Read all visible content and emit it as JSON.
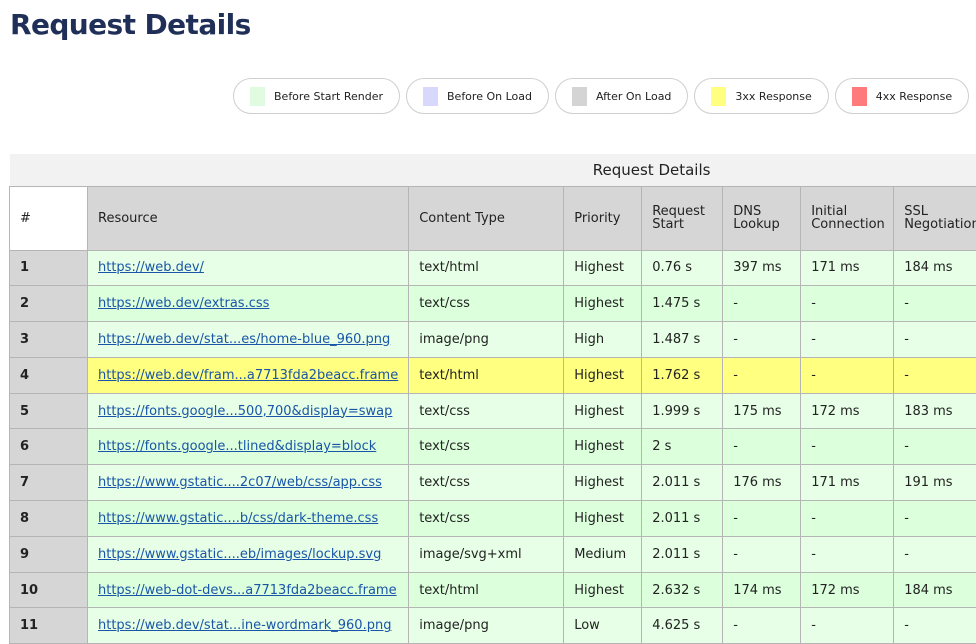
{
  "page": {
    "title": "Request Details"
  },
  "legend": [
    {
      "label": "Before Start Render",
      "color": "#e1fbe1",
      "icon": "swatch-before-start-render"
    },
    {
      "label": "Before On Load",
      "color": "#d8d8fc",
      "icon": "swatch-before-on-load"
    },
    {
      "label": "After On Load",
      "color": "#d4d4d4",
      "icon": "swatch-after-on-load"
    },
    {
      "label": "3xx Response",
      "color": "#ffff80",
      "icon": "swatch-3xx-response"
    },
    {
      "label": "4xx Response",
      "color": "#ff7b7b",
      "icon": "swatch-4xx-response"
    }
  ],
  "table": {
    "group_header": "Request Details",
    "columns": [
      "#",
      "Resource",
      "Content Type",
      "Priority",
      "Request Start",
      "DNS Lookup",
      "Initial Connection",
      "SSL Negotiation"
    ],
    "rows": [
      {
        "num": "1",
        "resource": "https://web.dev/",
        "content_type": "text/html",
        "priority": "Highest",
        "request_start": "0.76 s",
        "dns": "397 ms",
        "initial_connection": "171 ms",
        "ssl": "184 ms",
        "status": "before-start-render"
      },
      {
        "num": "2",
        "resource": "https://web.dev/extras.css",
        "content_type": "text/css",
        "priority": "Highest",
        "request_start": "1.475 s",
        "dns": "-",
        "initial_connection": "-",
        "ssl": "-",
        "status": "before-start-render"
      },
      {
        "num": "3",
        "resource": "https://web.dev/stat...es/home-blue_960.png",
        "content_type": "image/png",
        "priority": "High",
        "request_start": "1.487 s",
        "dns": "-",
        "initial_connection": "-",
        "ssl": "-",
        "status": "before-start-render"
      },
      {
        "num": "4",
        "resource": "https://web.dev/fram...a7713fda2beacc.frame",
        "content_type": "text/html",
        "priority": "Highest",
        "request_start": "1.762 s",
        "dns": "-",
        "initial_connection": "-",
        "ssl": "-",
        "status": "3xx-response"
      },
      {
        "num": "5",
        "resource": "https://fonts.google...500,700&display=swap",
        "content_type": "text/css",
        "priority": "Highest",
        "request_start": "1.999 s",
        "dns": "175 ms",
        "initial_connection": "172 ms",
        "ssl": "183 ms",
        "status": "before-start-render"
      },
      {
        "num": "6",
        "resource": "https://fonts.google...tlined&display=block",
        "content_type": "text/css",
        "priority": "Highest",
        "request_start": "2 s",
        "dns": "-",
        "initial_connection": "-",
        "ssl": "-",
        "status": "before-start-render"
      },
      {
        "num": "7",
        "resource": "https://www.gstatic....2c07/web/css/app.css",
        "content_type": "text/css",
        "priority": "Highest",
        "request_start": "2.011 s",
        "dns": "176 ms",
        "initial_connection": "171 ms",
        "ssl": "191 ms",
        "status": "before-start-render"
      },
      {
        "num": "8",
        "resource": "https://www.gstatic....b/css/dark-theme.css",
        "content_type": "text/css",
        "priority": "Highest",
        "request_start": "2.011 s",
        "dns": "-",
        "initial_connection": "-",
        "ssl": "-",
        "status": "before-start-render"
      },
      {
        "num": "9",
        "resource": "https://www.gstatic....eb/images/lockup.svg",
        "content_type": "image/svg+xml",
        "priority": "Medium",
        "request_start": "2.011 s",
        "dns": "-",
        "initial_connection": "-",
        "ssl": "-",
        "status": "before-start-render"
      },
      {
        "num": "10",
        "resource": "https://web-dot-devs...a7713fda2beacc.frame",
        "content_type": "text/html",
        "priority": "Highest",
        "request_start": "2.632 s",
        "dns": "174 ms",
        "initial_connection": "172 ms",
        "ssl": "184 ms",
        "status": "before-start-render"
      },
      {
        "num": "11",
        "resource": "https://web.dev/stat...ine-wordmark_960.png",
        "content_type": "image/png",
        "priority": "Low",
        "request_start": "4.625 s",
        "dns": "-",
        "initial_connection": "-",
        "ssl": "-",
        "status": "before-start-render"
      }
    ]
  }
}
